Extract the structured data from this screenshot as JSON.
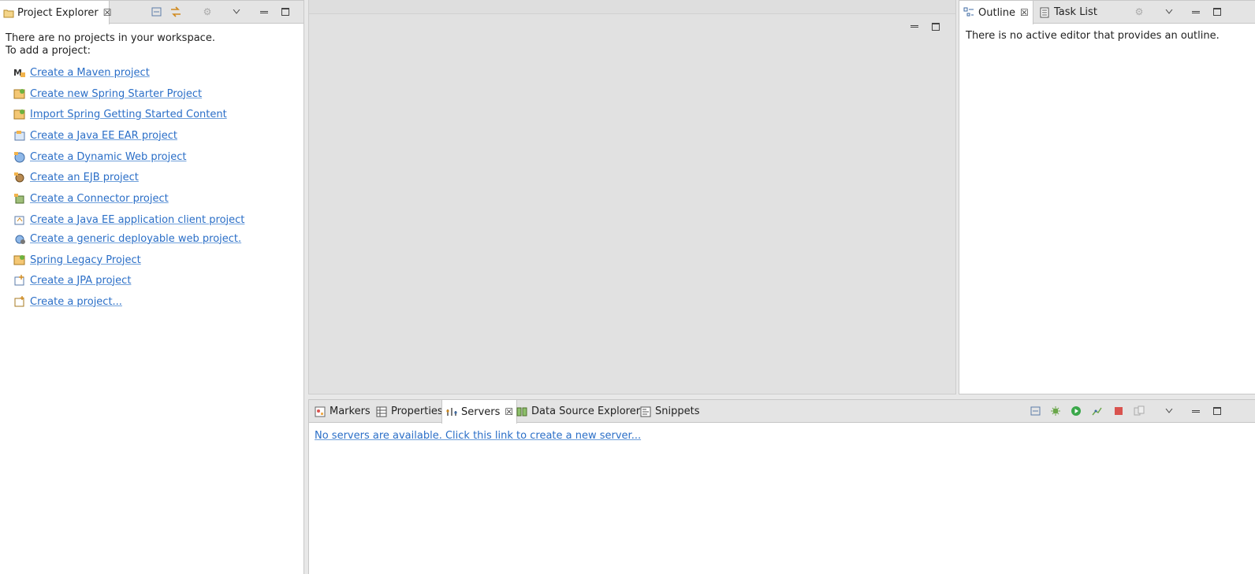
{
  "project_explorer": {
    "tab_label": "Project Explorer",
    "intro_line1": "There are no projects in your workspace.",
    "intro_line2": "To add a project:",
    "links": [
      {
        "label": "Create a Maven project",
        "icon": "maven-project-icon"
      },
      {
        "label": "Create new Spring Starter Project",
        "icon": "spring-starter-icon"
      },
      {
        "label": "Import Spring Getting Started Content",
        "icon": "spring-import-icon"
      },
      {
        "label": "Create a Java EE EAR project",
        "icon": "ear-project-icon"
      },
      {
        "label": "Create a Dynamic Web project",
        "icon": "web-project-icon"
      },
      {
        "label": "Create an EJB project",
        "icon": "ejb-project-icon"
      },
      {
        "label": "Create a Connector project",
        "icon": "connector-project-icon"
      },
      {
        "label": "Create a Java EE application client project",
        "icon": "app-client-project-icon"
      },
      {
        "label": "Create a generic deployable web project.",
        "icon": "generic-web-project-icon"
      },
      {
        "label": "Spring Legacy Project",
        "icon": "spring-legacy-icon"
      },
      {
        "label": "Create a JPA project",
        "icon": "jpa-project-icon"
      },
      {
        "label": "Create a project...",
        "icon": "new-project-icon"
      }
    ]
  },
  "outline": {
    "tabs": [
      {
        "label": "Outline"
      },
      {
        "label": "Task List"
      }
    ],
    "message": "There is no active editor that provides an outline."
  },
  "bottom": {
    "tabs": [
      {
        "label": "Markers"
      },
      {
        "label": "Properties"
      },
      {
        "label": "Servers"
      },
      {
        "label": "Data Source Explorer"
      },
      {
        "label": "Snippets"
      }
    ],
    "servers_message": "No servers are available. Click this link to create a new server..."
  },
  "colors": {
    "link": "#2a6ec7",
    "tab_bg": "#e4e4e4",
    "editor_bg": "#e1e1e1",
    "server_start": "#3aa84a",
    "server_stop": "#d9534f"
  }
}
